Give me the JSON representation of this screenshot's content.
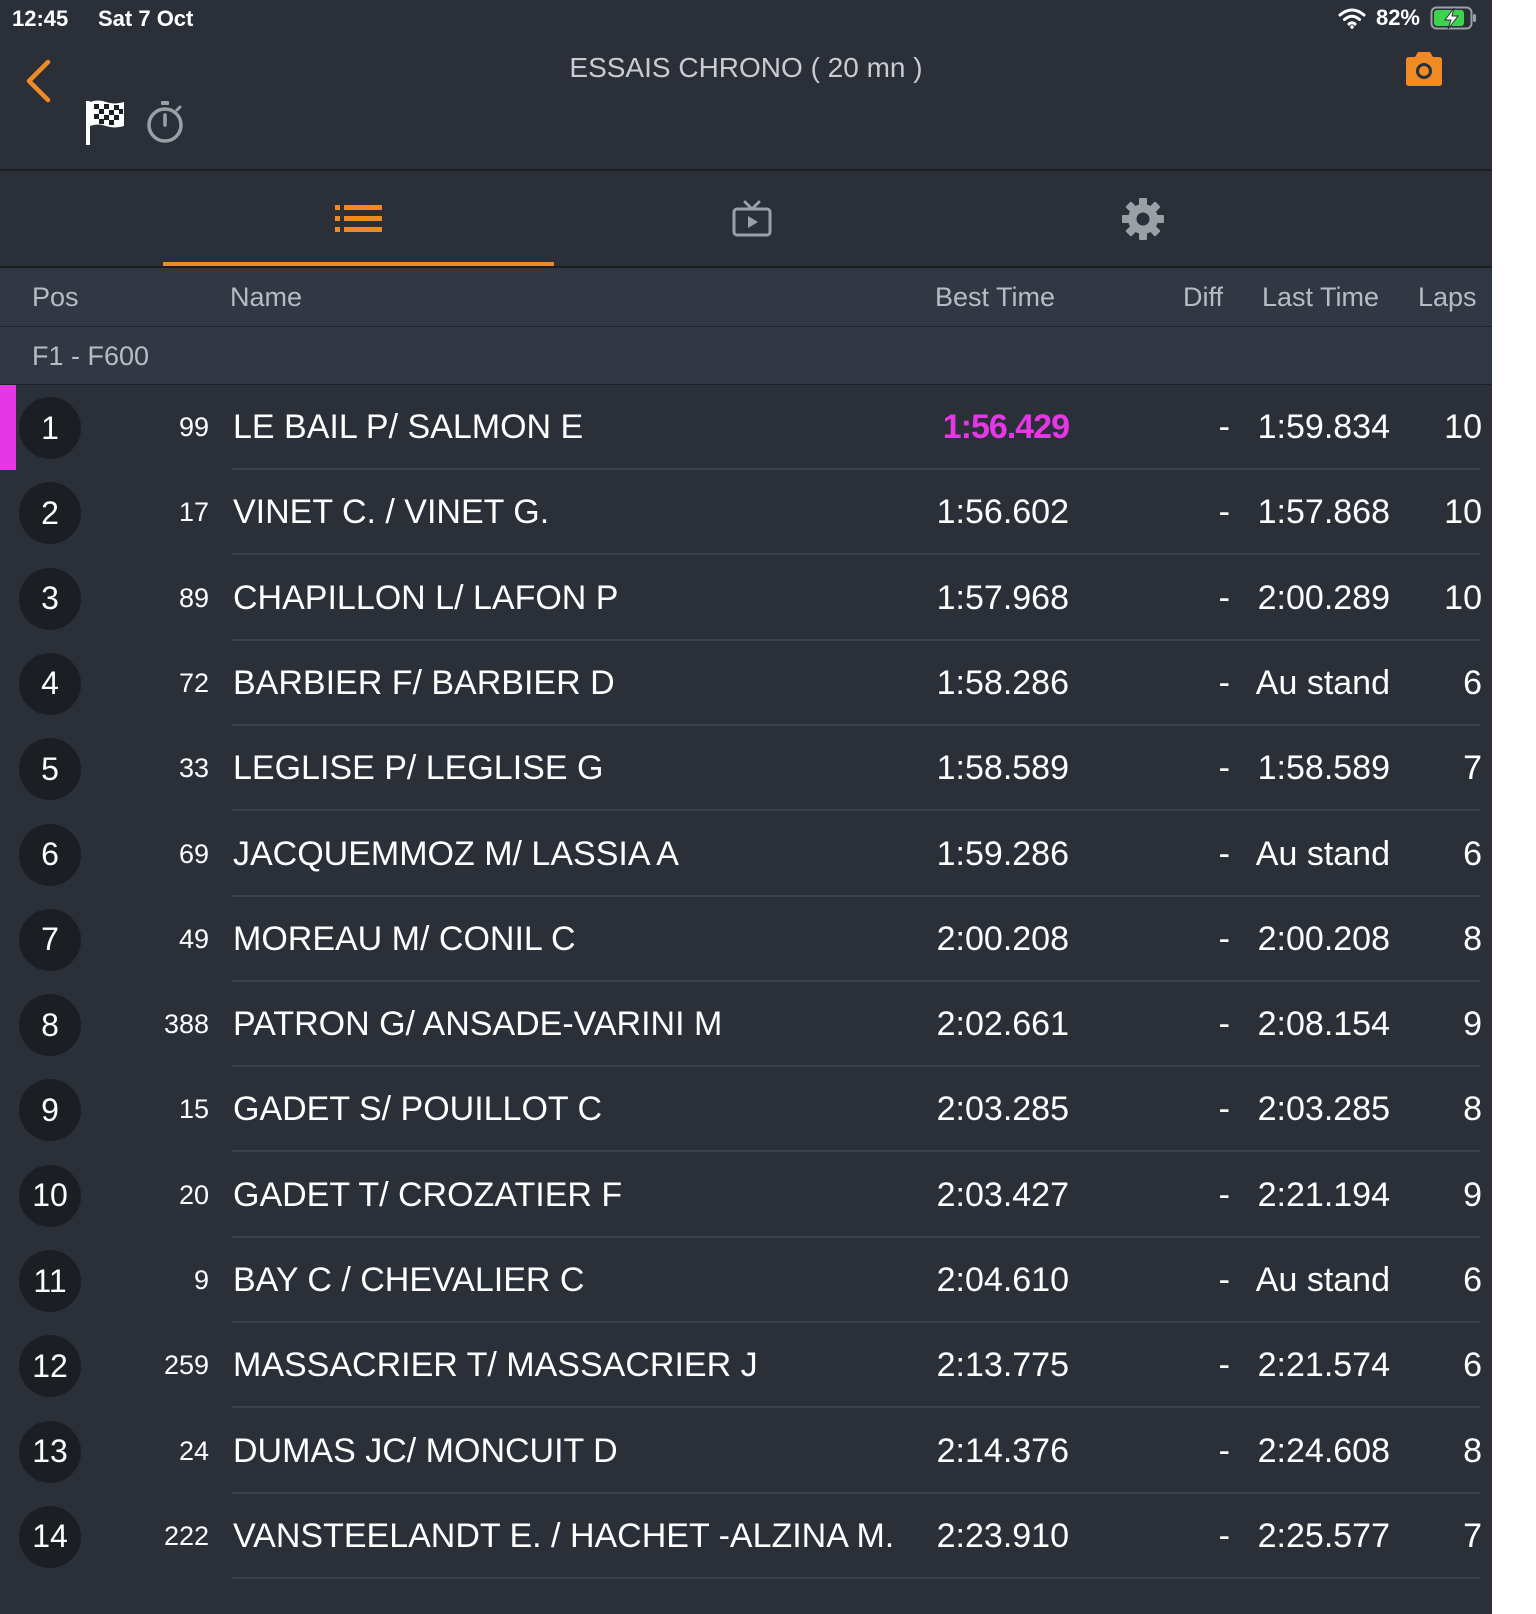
{
  "status_bar": {
    "time": "12:45",
    "date": "Sat 7 Oct",
    "battery_percent": "82%"
  },
  "header": {
    "title": "ESSAIS CHRONO ( 20 mn )",
    "back_icon": "chevron-left-icon",
    "camera_icon": "camera-icon",
    "flag_icon": "checkered-flag-icon",
    "stopwatch_icon": "stopwatch-icon"
  },
  "tabs": [
    {
      "icon": "list-icon",
      "active": true
    },
    {
      "icon": "tv-icon",
      "active": false
    },
    {
      "icon": "gear-icon",
      "active": false
    }
  ],
  "columns": {
    "pos": "Pos",
    "name": "Name",
    "best_time": "Best Time",
    "diff": "Diff",
    "last_time": "Last Time",
    "laps": "Laps"
  },
  "category": "F1 - F600",
  "colors": {
    "accent": "#f08a24",
    "fastest": "#e637e6",
    "background": "#2a2f38",
    "header_row": "#323843"
  },
  "rows": [
    {
      "pos": "1",
      "num": "99",
      "name": "LE BAIL P/ SALMON E",
      "best": "1:56.429",
      "diff": "-",
      "last": "1:59.834",
      "laps": "10",
      "fastest": true
    },
    {
      "pos": "2",
      "num": "17",
      "name": "VINET C. / VINET G.",
      "best": "1:56.602",
      "diff": "-",
      "last": "1:57.868",
      "laps": "10"
    },
    {
      "pos": "3",
      "num": "89",
      "name": "CHAPILLON L/ LAFON P",
      "best": "1:57.968",
      "diff": "-",
      "last": "2:00.289",
      "laps": "10"
    },
    {
      "pos": "4",
      "num": "72",
      "name": "BARBIER F/ BARBIER D",
      "best": "1:58.286",
      "diff": "-",
      "last": "Au stand",
      "laps": "6"
    },
    {
      "pos": "5",
      "num": "33",
      "name": "LEGLISE P/ LEGLISE G",
      "best": "1:58.589",
      "diff": "-",
      "last": "1:58.589",
      "laps": "7"
    },
    {
      "pos": "6",
      "num": "69",
      "name": "JACQUEMMOZ M/ LASSIA A",
      "best": "1:59.286",
      "diff": "-",
      "last": "Au stand",
      "laps": "6"
    },
    {
      "pos": "7",
      "num": "49",
      "name": "MOREAU M/ CONIL C",
      "best": "2:00.208",
      "diff": "-",
      "last": "2:00.208",
      "laps": "8"
    },
    {
      "pos": "8",
      "num": "388",
      "name": "PATRON G/ ANSADE-VARINI M",
      "best": "2:02.661",
      "diff": "-",
      "last": "2:08.154",
      "laps": "9"
    },
    {
      "pos": "9",
      "num": "15",
      "name": "GADET S/ POUILLOT C",
      "best": "2:03.285",
      "diff": "-",
      "last": "2:03.285",
      "laps": "8"
    },
    {
      "pos": "10",
      "num": "20",
      "name": "GADET T/ CROZATIER F",
      "best": "2:03.427",
      "diff": "-",
      "last": "2:21.194",
      "laps": "9"
    },
    {
      "pos": "11",
      "num": "9",
      "name": "BAY C / CHEVALIER C",
      "best": "2:04.610",
      "diff": "-",
      "last": "Au stand",
      "laps": "6"
    },
    {
      "pos": "12",
      "num": "259",
      "name": "MASSACRIER T/ MASSACRIER J",
      "best": "2:13.775",
      "diff": "-",
      "last": "2:21.574",
      "laps": "6"
    },
    {
      "pos": "13",
      "num": "24",
      "name": "DUMAS JC/ MONCUIT D",
      "best": "2:14.376",
      "diff": "-",
      "last": "2:24.608",
      "laps": "8"
    },
    {
      "pos": "14",
      "num": "222",
      "name": "VANSTEELANDT E. / HACHET -ALZINA M.",
      "best": "2:23.910",
      "diff": "-",
      "last": "2:25.577",
      "laps": "7"
    }
  ]
}
